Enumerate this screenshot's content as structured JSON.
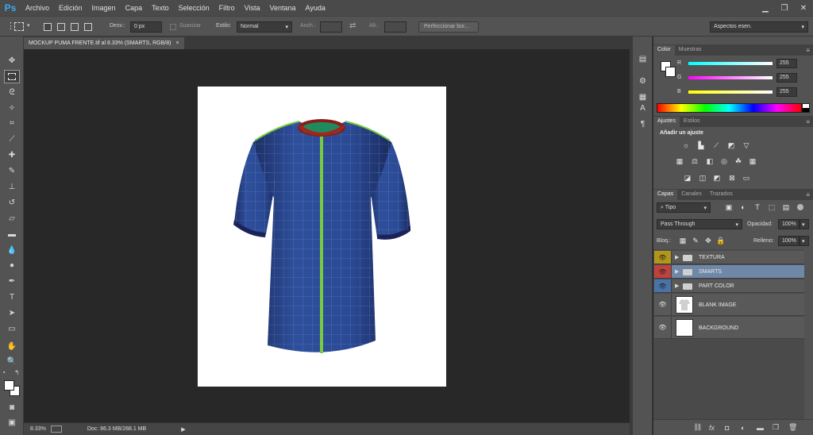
{
  "app": {
    "logo": "Ps"
  },
  "menu": [
    "Archivo",
    "Edición",
    "Imagen",
    "Capa",
    "Texto",
    "Selección",
    "Filtro",
    "Vista",
    "Ventana",
    "Ayuda"
  ],
  "options": {
    "desv_label": "Desv.:",
    "desv_value": "0 px",
    "suavizar_label": "Suavizar",
    "estilo_label": "Estilo:",
    "estilo_value": "Normal",
    "anch_label": "Anch.:",
    "alt_label": "Alt.:",
    "refine_button": "Perfeccionar bor...",
    "workspace": "Aspectos esen."
  },
  "document": {
    "tab_title": "MOCKUP PUMA FRENTE.tif al 8.33% (SMARTS, RGB/8)",
    "close": "×"
  },
  "status": {
    "zoom": "8.33%",
    "doc_info": "Doc: 86.3 MB/288.1 MB"
  },
  "color_panel": {
    "tabs": [
      "Color",
      "Muestras"
    ],
    "channels": [
      {
        "label": "R",
        "value": "255"
      },
      {
        "label": "G",
        "value": "255"
      },
      {
        "label": "B",
        "value": "255"
      }
    ]
  },
  "adjust_panel": {
    "tabs": [
      "Ajustes",
      "Estilos"
    ],
    "heading": "Añadir un ajuste"
  },
  "layers_panel": {
    "tabs": [
      "Capas",
      "Canales",
      "Trazados"
    ],
    "filter": "Tipo",
    "blend_mode": "Pass Through",
    "opacity_label": "Opacidad:",
    "opacity_value": "100%",
    "lock_label": "Bloq.:",
    "fill_label": "Relleno:",
    "fill_value": "100%",
    "layers": [
      {
        "name": "TEXTURA",
        "color": "#b0961a"
      },
      {
        "name": "SMARTS",
        "color": "#c0423c"
      },
      {
        "name": "PART COLOR",
        "color": "#4a72a8"
      },
      {
        "name": "BLANK IMAGE"
      },
      {
        "name": "BACKGROUND"
      }
    ]
  }
}
